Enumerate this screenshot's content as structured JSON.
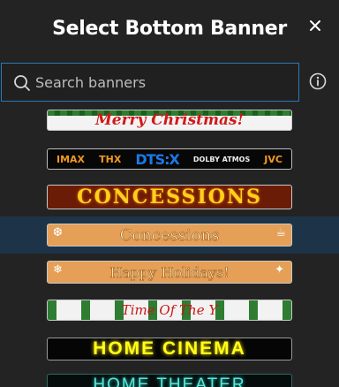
{
  "dialog": {
    "title": "Select Bottom Banner",
    "close_icon": "close-icon"
  },
  "search": {
    "placeholder": "Search banners",
    "value": "",
    "icon": "search-icon",
    "info_icon": "info-icon"
  },
  "banners": [
    {
      "id": "merry-christmas",
      "text": "Merry Christmas!",
      "selected": false
    },
    {
      "id": "imax-thx",
      "logos": [
        "IMAX",
        "THX",
        "DTS:X",
        "DOLBY ATMOS",
        "JVC"
      ],
      "selected": false
    },
    {
      "id": "concessions-marquee",
      "text": "CONCESSIONS",
      "selected": false
    },
    {
      "id": "concessions-orange",
      "text": "Concessions",
      "selected": true
    },
    {
      "id": "happy-holidays",
      "text": "Happy Holidays!",
      "selected": false
    },
    {
      "id": "time-of-the-year",
      "text": "Time Of The Y",
      "selected": false
    },
    {
      "id": "home-cinema",
      "text": "HOME CINEMA",
      "selected": false
    },
    {
      "id": "home-theater",
      "text": "HOME THEATER",
      "selected": false
    }
  ],
  "colors": {
    "background": "#232323",
    "selected_row": "#1d3347",
    "search_border": "#2b78b6"
  }
}
